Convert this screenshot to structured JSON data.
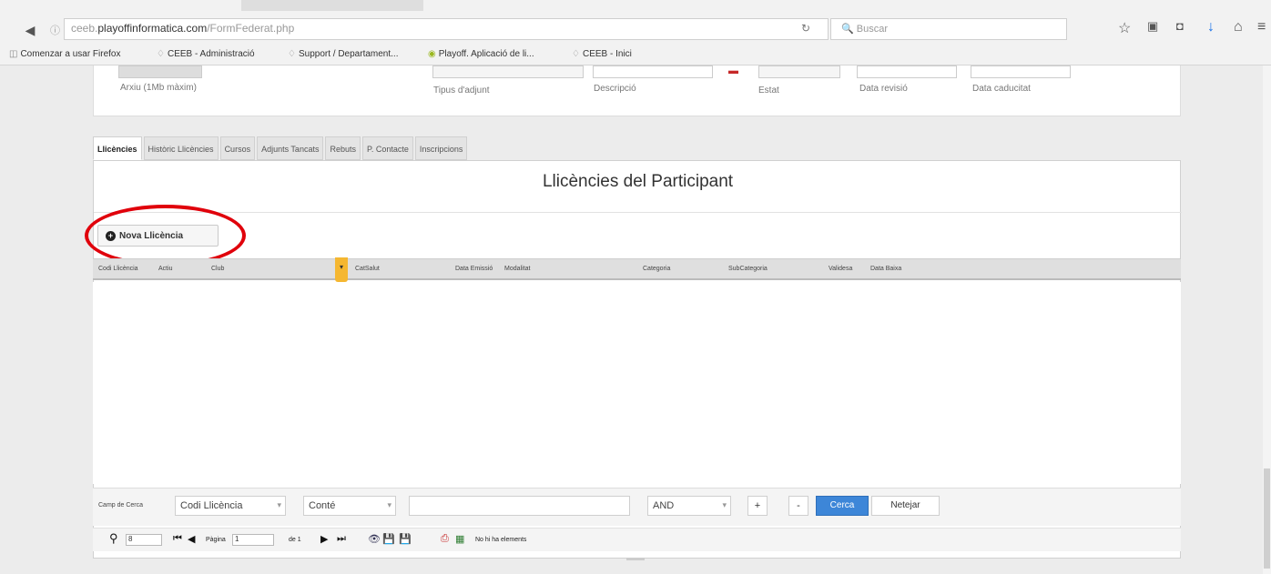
{
  "browser": {
    "url_prefix": "ceeb.",
    "url_domain": "playoffinformatica.com",
    "url_path": "/FormFederat.php",
    "search_placeholder": "Buscar",
    "bookmarks": [
      "Comenzar a usar Firefox",
      "CEEB - Administració",
      "Support / Departament...",
      "Playoff. Aplicació de li...",
      "CEEB - Inici"
    ]
  },
  "top_form": {
    "file_hint": "Arxiu (1Mb màxim)",
    "labels": [
      "Tipus d'adjunt",
      "Descripció",
      "Estat",
      "Data revisió",
      "Data caducitat"
    ]
  },
  "tabs": [
    "Llicències",
    "Històric Llicències",
    "Cursos",
    "Adjunts Tancats",
    "Rebuts",
    "P. Contacte",
    "Inscripcions"
  ],
  "panel": {
    "title": "Llicències del Participant",
    "new_button": "Nova Llicència"
  },
  "grid": {
    "columns": [
      "Codi Llicència",
      "Actiu",
      "Club",
      "CatSalut",
      "Data Emissió",
      "Modalitat",
      "Categoria",
      "SubCategoria",
      "Validesa",
      "Data Baixa"
    ]
  },
  "search": {
    "label": "Camp de Cerca",
    "field": "Codi Llicència",
    "operator": "Conté",
    "logic": "AND",
    "plus": "+",
    "minus": "-",
    "search_button": "Cerca",
    "clear_button": "Netejar"
  },
  "pager": {
    "page_size": "8",
    "page_label": "Pàgina",
    "page_value": "1",
    "of_label": "de 1",
    "status": "No hi ha elements"
  },
  "colors": {
    "accent": "#3d86d8",
    "sort_marker": "#f5b731",
    "highlight": "#e0000b"
  }
}
